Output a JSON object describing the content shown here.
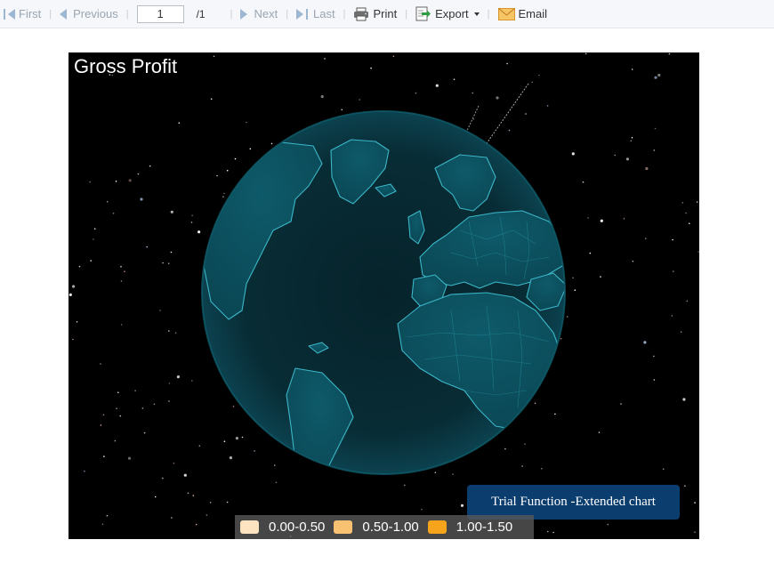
{
  "toolbar": {
    "first": "First",
    "previous": "Previous",
    "page_value": "1",
    "page_total": "/1",
    "next": "Next",
    "last": "Last",
    "print": "Print",
    "export": "Export",
    "email": "Email"
  },
  "chart": {
    "title": "Gross Profit",
    "trial_notice": "Trial Function -Extended chart",
    "legend": [
      {
        "label": "0.00-0.50",
        "color": "#fde3c0"
      },
      {
        "label": "0.50-1.00",
        "color": "#f9c273"
      },
      {
        "label": "1.00-1.50",
        "color": "#f5a41c"
      }
    ]
  },
  "chart_data": {
    "type": "heatmap",
    "title": "Gross Profit",
    "legend_placement": "bottom",
    "color_ranges": [
      {
        "range": [
          0.0,
          0.5
        ],
        "label": "0.00-0.50",
        "color": "#fde3c0"
      },
      {
        "range": [
          0.5,
          1.0
        ],
        "label": "0.50-1.00",
        "color": "#f9c273"
      },
      {
        "range": [
          1.0,
          1.5
        ],
        "label": "1.00-1.50",
        "color": "#f5a41c"
      }
    ]
  }
}
